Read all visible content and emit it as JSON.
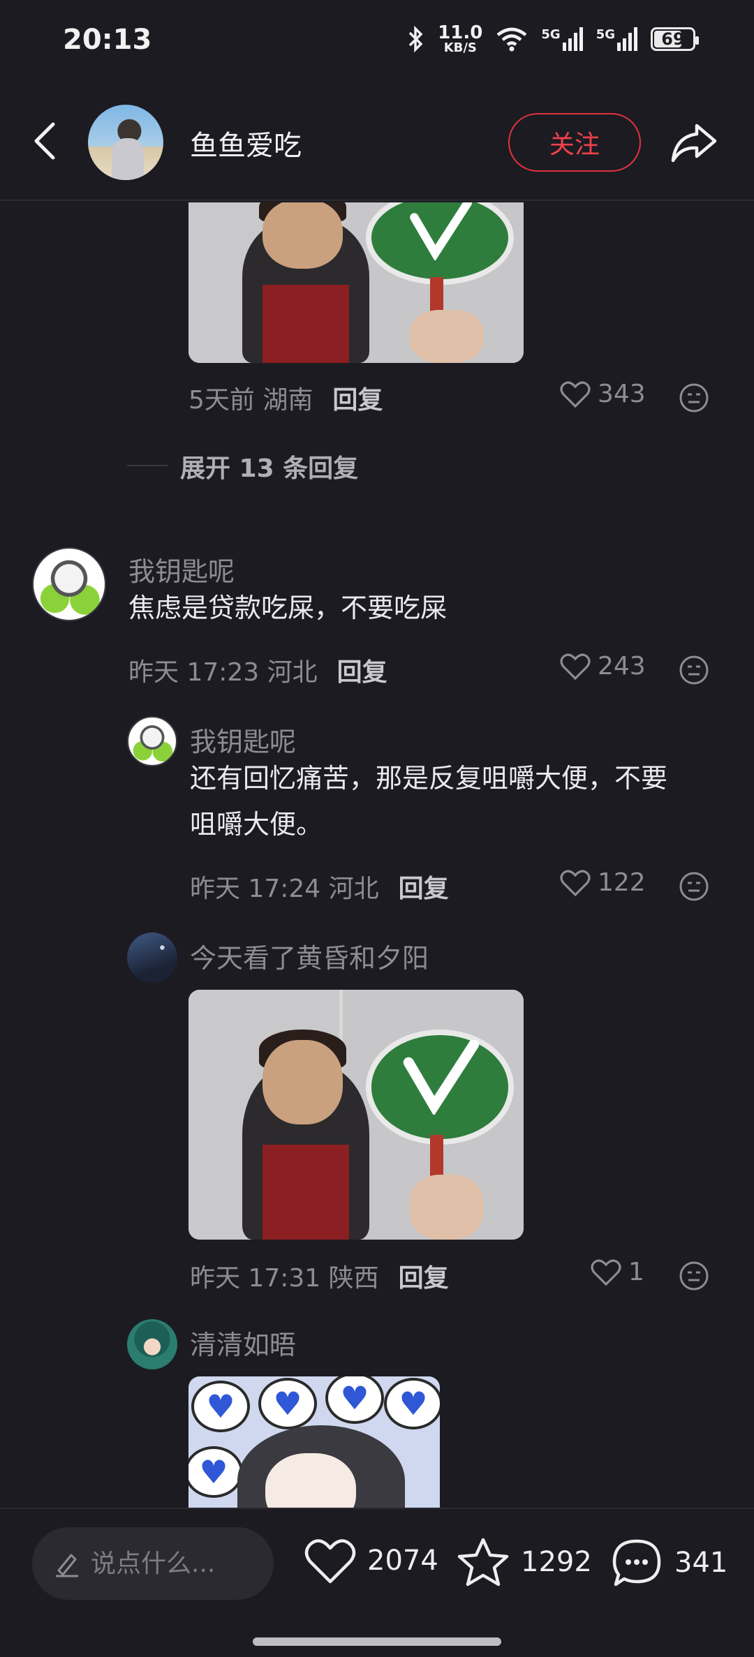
{
  "status_bar": {
    "time": "20:13",
    "net_speed": "11.0",
    "net_unit": "KB/S",
    "signal1": "5G",
    "signal2": "5G",
    "battery": "69"
  },
  "header": {
    "username": "鱼鱼爱吃",
    "follow_label": "关注"
  },
  "comments": {
    "top_reply": {
      "time_location": "5天前 湖南",
      "reply_label": "回复",
      "likes": "343"
    },
    "expand_label": "展开 13 条回复",
    "main": {
      "author": "我钥匙呢",
      "text": "焦虑是贷款吃屎，不要吃屎",
      "time_location": "昨天 17:23 河北",
      "reply_label": "回复",
      "likes": "243"
    },
    "reply1": {
      "author": "我钥匙呢",
      "text_line1": "还有回忆痛苦，那是反复咀嚼大便，不要",
      "text_line2": "咀嚼大便。",
      "time_location": "昨天 17:24 河北",
      "reply_label": "回复",
      "likes": "122"
    },
    "reply2": {
      "author": "今天看了黄昏和夕阳",
      "time_location": "昨天 17:31 陕西",
      "reply_label": "回复",
      "likes": "1"
    },
    "reply3": {
      "author": "清清如晤"
    }
  },
  "bottom_bar": {
    "input_placeholder": "说点什么...",
    "likes": "2074",
    "favorites": "1292",
    "comments": "341"
  },
  "colors": {
    "background": "#1c1b22",
    "accent_red": "#e3323d",
    "muted_text": "#8d8c93"
  }
}
